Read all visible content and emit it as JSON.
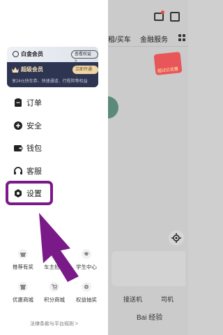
{
  "background": {
    "tabs": [
      "租/买车",
      "金融服务"
    ],
    "red_packet_text": "超过亿优惠",
    "bottom_items": [
      "接送机",
      "司机"
    ],
    "watermark": "Bai 经验"
  },
  "member_card": {
    "platinum_label": "白金会员",
    "view_rights_label": "查看权益 >",
    "super_label": "超级会员",
    "open_now_label": "立即开通 >",
    "super_desc": "享24元快车券、快速通道、行程险等权益"
  },
  "menu": [
    {
      "icon": "order-icon",
      "label": "订单"
    },
    {
      "icon": "shield-plus-icon",
      "label": "安全"
    },
    {
      "icon": "wallet-icon",
      "label": "钱包"
    },
    {
      "icon": "headset-icon",
      "label": "客服"
    },
    {
      "icon": "gear-icon",
      "label": "设置"
    }
  ],
  "grid": [
    {
      "icon": "gift-icon",
      "label": "推荐有奖"
    },
    {
      "icon": "car-icon",
      "label": "车主招募"
    },
    {
      "icon": "graduation-cap-icon",
      "label": "学生中心"
    },
    {
      "icon": "store-icon",
      "label": "优惠商城"
    },
    {
      "icon": "cart-icon",
      "label": "积分商城"
    },
    {
      "icon": "lottery-icon",
      "label": "权益抽奖"
    }
  ],
  "legal_link": "法律条款与平台规则 >",
  "colors": {
    "highlight": "#7a1a88",
    "super_member_bg": "#2d3552",
    "super_member_text": "#f6dfb2"
  }
}
